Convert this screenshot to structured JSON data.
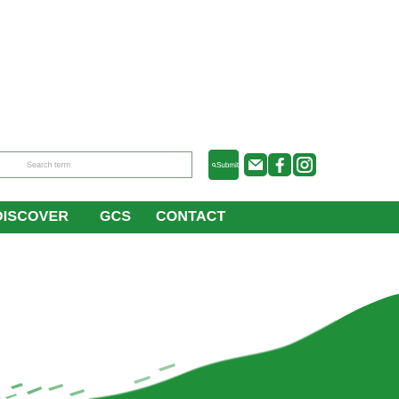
{
  "header": {
    "search": {
      "placeholder": "Search term",
      "button_label": "Submit"
    },
    "social_icons": [
      "email-icon",
      "facebook-icon",
      "instagram-icon"
    ]
  },
  "nav": {
    "items": [
      {
        "label": "DISCOVER"
      },
      {
        "label": "GCS"
      },
      {
        "label": "CONTACT"
      }
    ]
  },
  "colors": {
    "brand_green": "#1e8a3b",
    "white": "#ffffff",
    "hero_green": "#1f8f3a"
  }
}
